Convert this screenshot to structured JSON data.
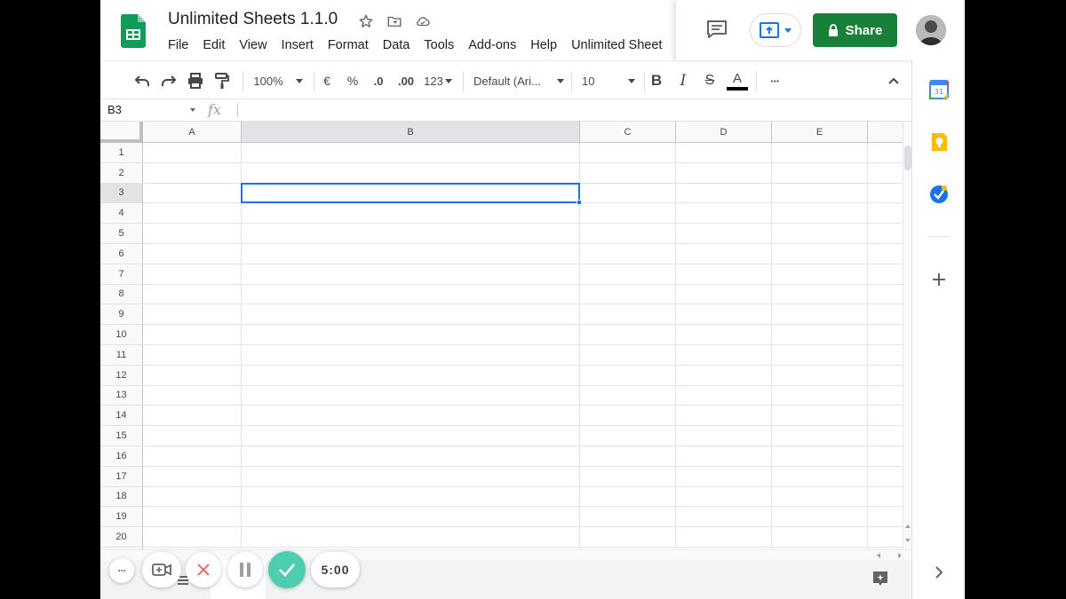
{
  "document": {
    "title": "Unlimited Sheets 1.1.0"
  },
  "menu": [
    "File",
    "Edit",
    "View",
    "Insert",
    "Format",
    "Data",
    "Tools",
    "Add-ons",
    "Help",
    "Unlimited Sheet"
  ],
  "header": {
    "share_label": "Share"
  },
  "toolbar": {
    "zoom": "100%",
    "currency": "€",
    "percent": "%",
    "decrease_decimal": ".0",
    "increase_decimal": ".00",
    "number_format": "123",
    "font": "Default (Ari...",
    "font_size": "10",
    "bold": "B",
    "italic": "I",
    "strike": "S",
    "text_color": "A",
    "more": "···"
  },
  "formula_bar": {
    "cell_ref": "B3",
    "fx": "fx"
  },
  "grid": {
    "columns": [
      "A",
      "B",
      "C",
      "D",
      "E"
    ],
    "rows": [
      "1",
      "2",
      "3",
      "4",
      "5",
      "6",
      "7",
      "8",
      "9",
      "10",
      "11",
      "12",
      "13",
      "14",
      "15",
      "16",
      "17",
      "18",
      "19",
      "20"
    ],
    "selected_column": "B",
    "selected_row": "3"
  },
  "recorder": {
    "timer": "5:00",
    "more": "···"
  },
  "colors": {
    "accent_blue": "#1a73e8",
    "share_green": "#188038",
    "sheets_green": "#0f9d58",
    "record_teal": "#4ecdb0"
  }
}
